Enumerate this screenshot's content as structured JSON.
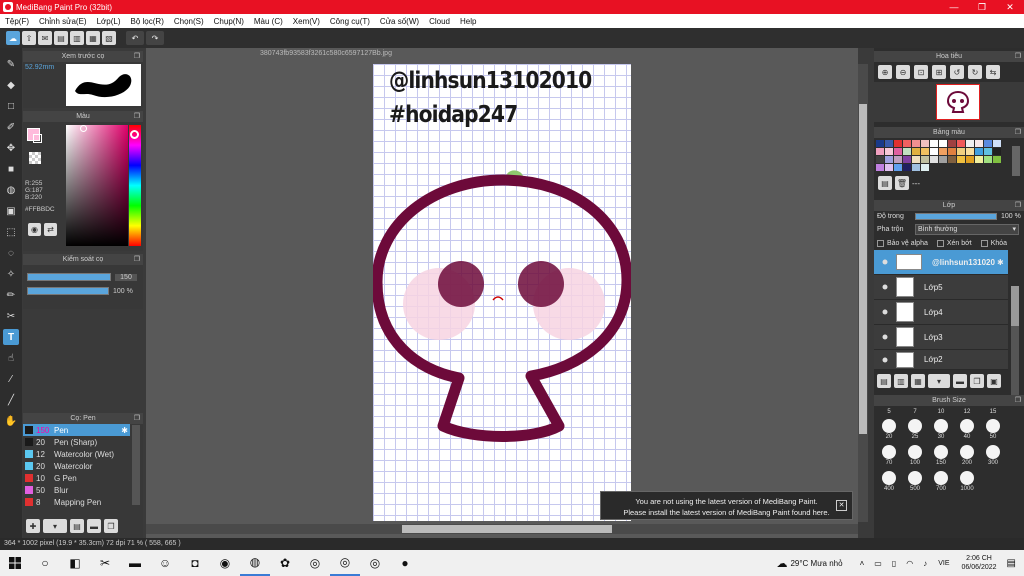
{
  "window": {
    "title": "MediBang Paint Pro (32bit)",
    "min": "—",
    "max": "❐",
    "close": "✕"
  },
  "menu": [
    "Tệp(F)",
    "Chỉnh sửa(E)",
    "Lớp(L)",
    "Bộ lọc(R)",
    "Chọn(S)",
    "Chụp(N)",
    "Màu (C)",
    "Xem(V)",
    "Công cụ(T)",
    "Cửa số(W)",
    "Cloud",
    "Help"
  ],
  "preview_panel": {
    "title": "Xem trước cọ",
    "size": "52.92mm"
  },
  "color_panel": {
    "title": "Màu",
    "r": "R:255",
    "g": "G:187",
    "b": "B:220",
    "hex": "#FFBBDC",
    "fg": "#ffbbdc"
  },
  "brush_control": {
    "title": "Kiểm soát cọ",
    "size": "150",
    "opacity": "100 %"
  },
  "brush_list": {
    "title": "Cọ: Pen",
    "items": [
      {
        "size": "150",
        "name": "Pen",
        "color": "#1a1a1a"
      },
      {
        "size": "20",
        "name": "Pen (Sharp)",
        "color": "#1a1a1a"
      },
      {
        "size": "12",
        "name": "Watercolor (Wet)",
        "color": "#5bc8f0"
      },
      {
        "size": "20",
        "name": "Watercolor",
        "color": "#5bc8f0"
      },
      {
        "size": "10",
        "name": "G Pen",
        "color": "#e03030"
      },
      {
        "size": "50",
        "name": "Blur",
        "color": "#e060e0"
      },
      {
        "size": "8",
        "name": "Mapping Pen",
        "color": "#e03030"
      }
    ]
  },
  "document": {
    "name": "380743fb93583f3261c580c6597127Bb.jpg"
  },
  "canvas_text": {
    "line1": "@linhsun13102010",
    "line2": "#hoidap247"
  },
  "navigator": {
    "title": "Hoa tiêu"
  },
  "palette": {
    "title": "Bảng màu",
    "more": "---"
  },
  "layers": {
    "title": "Lớp",
    "opacity_label": "Độ trong",
    "opacity_value": "100 %",
    "blend_label": "Pha trộn",
    "blend_value": "Bình thường",
    "protect_alpha": "Bảo vệ alpha",
    "clipping": "Xén bớt",
    "lock": "Khóa",
    "items": [
      "@linhsun131020",
      "Lớp5",
      "Lớp4",
      "Lớp3",
      "Lớp2"
    ]
  },
  "brush_size": {
    "title": "Brush Size",
    "header": [
      "5",
      "7",
      "10",
      "12",
      "15"
    ],
    "rows": [
      [
        "20",
        "25",
        "30",
        "40",
        "50"
      ],
      [
        "70",
        "100",
        "150",
        "200",
        "300"
      ],
      [
        "400",
        "500",
        "700",
        "1000"
      ]
    ]
  },
  "notification": {
    "line1": "You are not using the latest version of MediBang Paint.",
    "line2": "Please install the latest version of MediBang Paint found here.",
    "close": "✕"
  },
  "status": {
    "text": "364 * 1002 pixel   (19.9 * 35.3cm)  72 dpi  71 %   ( 558, 665 )"
  },
  "taskbar": {
    "weather": "29°C  Mưa nhỏ",
    "lang": "VIE",
    "time": "2:06 CH",
    "date": "06/06/2022"
  }
}
